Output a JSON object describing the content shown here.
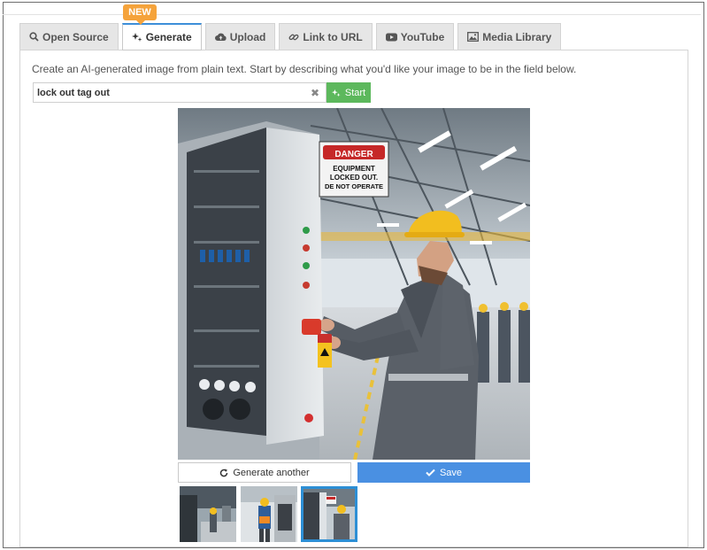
{
  "badge": "NEW",
  "tabs": [
    {
      "label": "Open Source",
      "icon": "search-icon"
    },
    {
      "label": "Generate",
      "icon": "sparkle-icon"
    },
    {
      "label": "Upload",
      "icon": "cloud-upload-icon"
    },
    {
      "label": "Link to URL",
      "icon": "link-icon"
    },
    {
      "label": "YouTube",
      "icon": "youtube-icon"
    },
    {
      "label": "Media Library",
      "icon": "image-icon"
    }
  ],
  "active_tab": "Generate",
  "generate": {
    "instruction": "Create an AI-generated image from plain text. Start by describing what you'd like your image to be in the field below.",
    "prompt_value": "lock out tag out",
    "start_label": "Start",
    "clear_icon": "close-icon"
  },
  "result": {
    "sign_line1": "DANGER",
    "sign_line2": "EQUIPMENT",
    "sign_line3": "LOCKED OUT.",
    "sign_line4": "DE NOT OPERATE",
    "generate_another_label": "Generate another",
    "save_label": "Save"
  },
  "thumbnails": {
    "count": 3,
    "selected_index": 2
  },
  "colors": {
    "accent": "#4a90e2",
    "start": "#5cb85c",
    "badge": "#f5a33b",
    "selected": "#2d8fd5"
  }
}
